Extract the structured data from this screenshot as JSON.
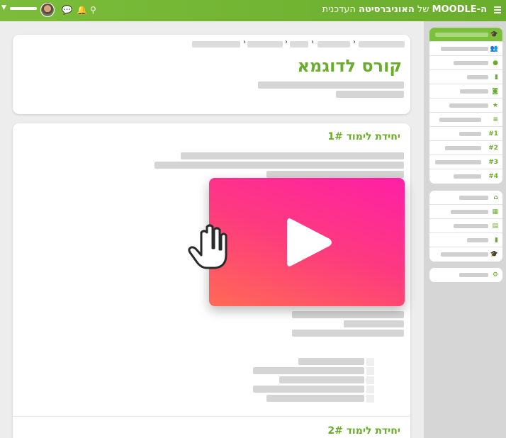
{
  "navbar": {
    "brand_bold": "ה-MOODLE",
    "brand_of": "של",
    "brand_univ": "האוניברסיטה",
    "brand_rest": "העדכנית",
    "menu_icon": "hamburger-icon",
    "search_icon": "search-icon",
    "bell_icon": "bell-icon",
    "chat_icon": "chat-icon",
    "user_menu_icon": "chevron-down-icon",
    "brand_color": "#6aad2c"
  },
  "course": {
    "title": "קורס לדוגמא"
  },
  "units": [
    {
      "title": "יחידת לימוד 1#"
    },
    {
      "title": "יחידת לימוד 2#"
    }
  ],
  "video": {
    "play_icon": "play-icon",
    "cursor_icon": "hand-cursor-icon",
    "gradient_from": "#ff6a55",
    "gradient_to": "#ff1fa6"
  },
  "sidebar": {
    "group1_icons": [
      "graduation-cap-icon",
      "users-icon",
      "badge-icon",
      "file-icon",
      "chat-icon",
      "star-icon",
      "list-icon",
      "section-1-icon",
      "section-2-icon",
      "section-3-icon",
      "section-4-icon"
    ],
    "group2_icons": [
      "home-icon",
      "dashboard-icon",
      "calendar-icon",
      "file-icon",
      "graduation-cap-icon"
    ],
    "group3_icons": [
      "gear-icon"
    ]
  }
}
